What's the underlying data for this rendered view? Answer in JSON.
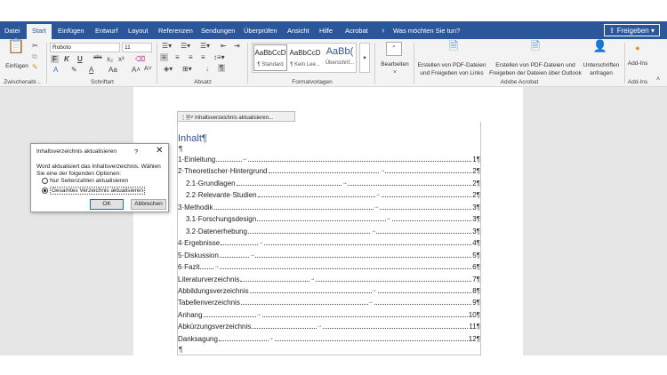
{
  "tabs": [
    "Datei",
    "Start",
    "Einfügen",
    "Entwurf",
    "Layout",
    "Referenzen",
    "Sendungen",
    "Überprüfen",
    "Ansicht",
    "Hilfe",
    "Acrobat"
  ],
  "tellme": "Was möchten Sie tun?",
  "share": "Freigeben",
  "ribbon": {
    "paste": "Einfügen",
    "clipboard": "Zwischenabl...",
    "font": "Roboto",
    "size": "11",
    "font_group": "Schriftart",
    "font_buttons": [
      "F",
      "K",
      "U",
      "abc",
      "x₂",
      "x²"
    ],
    "para_group": "Absatz",
    "styles": [
      {
        "preview": "AaBbCcD",
        "name": "¶ Standard"
      },
      {
        "preview": "AaBbCcD",
        "name": "¶ Kein Lee..."
      },
      {
        "preview": "AaBb(",
        "name": "Überschrif..."
      }
    ],
    "styles_group": "Formatvorlagen",
    "edit": "Bearbeiten",
    "acrobat": [
      "Erstellen von PDF-Dateien und Freigeben von Links",
      "Erstellen von PDF-Dateien und Freigeben der Dateien über Outlook",
      "Unterschriften anfragen"
    ],
    "acrobat_group": "Adobe Acrobat",
    "addins": "Add-Ins",
    "addins_group": "Add-Ins"
  },
  "toc_toolbar": "Inhaltsverzeichnis aktualisieren...",
  "toc_title": "Inhalt¶",
  "pilcrow": "¶",
  "toc": [
    {
      "label": "1·Einleitung",
      "page": "1¶",
      "level": 1
    },
    {
      "label": "2·Theoretischer·Hintergrund",
      "page": "2¶",
      "level": 1
    },
    {
      "label": "2.1·Grundlagen",
      "page": "2¶",
      "level": 2
    },
    {
      "label": "2.2·Relevante·Studien",
      "page": "2¶",
      "level": 2
    },
    {
      "label": "3·Methodik",
      "page": "3¶",
      "level": 1
    },
    {
      "label": "3.1·Forschungsdesign",
      "page": "3¶",
      "level": 2
    },
    {
      "label": "3.2·Datenerhebung",
      "page": "3¶",
      "level": 2
    },
    {
      "label": "4·Ergebnisse",
      "page": "4¶",
      "level": 1
    },
    {
      "label": "5·Diskussion",
      "page": "5¶",
      "level": 1
    },
    {
      "label": "6·Fazit",
      "page": "6¶",
      "level": 1
    },
    {
      "label": "Literaturverzeichnis",
      "page": "7¶",
      "level": 1
    },
    {
      "label": "Abbildungsverzeichnis",
      "page": "8¶",
      "level": 1
    },
    {
      "label": "Tabellenverzeichnis",
      "page": "9¶",
      "level": 1
    },
    {
      "label": "Anhang",
      "page": "10¶",
      "level": 1
    },
    {
      "label": "Abkürzungsverzeichnis",
      "page": "11¶",
      "level": 1
    },
    {
      "label": "Danksagung",
      "page": "12¶",
      "level": 1
    }
  ],
  "dialog": {
    "title": "Inhaltsverzeichnis aktualisieren",
    "help": "?",
    "close": "✕",
    "message": "Word aktualisiert das Inhaltsverzeichnis. Wählen Sie eine der folgenden Optionen:",
    "option1": "Nur Seitenzahlen aktualisieren",
    "option2": "Gesamtes Verzeichnis aktualisieren",
    "selected": 2,
    "ok": "OK",
    "cancel": "Abbrechen"
  }
}
